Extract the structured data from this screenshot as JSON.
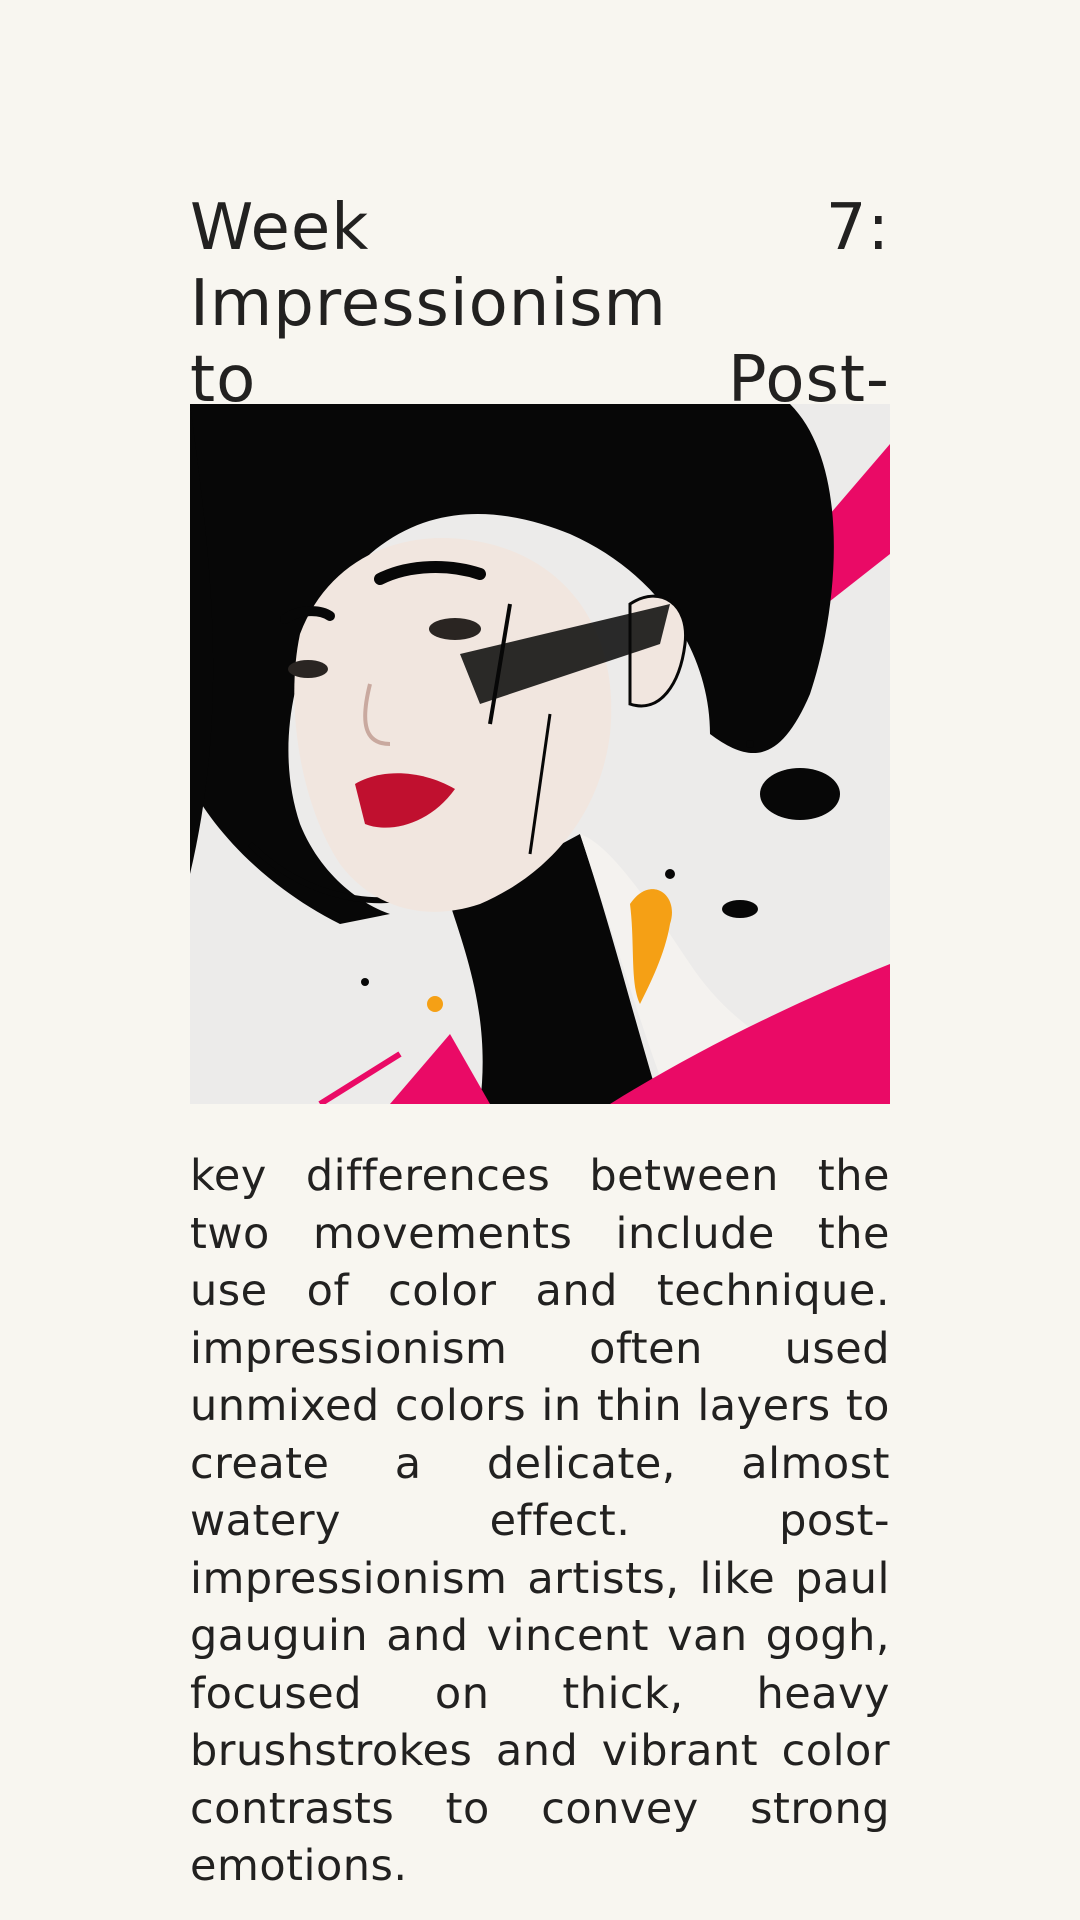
{
  "heading": {
    "line1": "Week 7: Impressionism",
    "line2": "to Post-Impressionism"
  },
  "artwork": {
    "icon": "portrait-illustration",
    "colors": {
      "background": "#ecebea",
      "hair": "#070707",
      "skin": "#f1e6df",
      "lips": "#c0102f",
      "accent_pink": "#ea0a66",
      "accent_orange": "#f5a015"
    }
  },
  "paragraph": {
    "text": "key differences between the two movements include the use of color and technique. impressionism often used unmixed colors in thin layers to create a delicate, almost watery effect. post-impressionism artists, like paul gauguin and vincent van gogh, focused on thick, heavy brushstrokes and vibrant color contrasts to convey strong emotions."
  },
  "theme": {
    "page_background": "#f8f6f0",
    "text_color": "#222120"
  }
}
